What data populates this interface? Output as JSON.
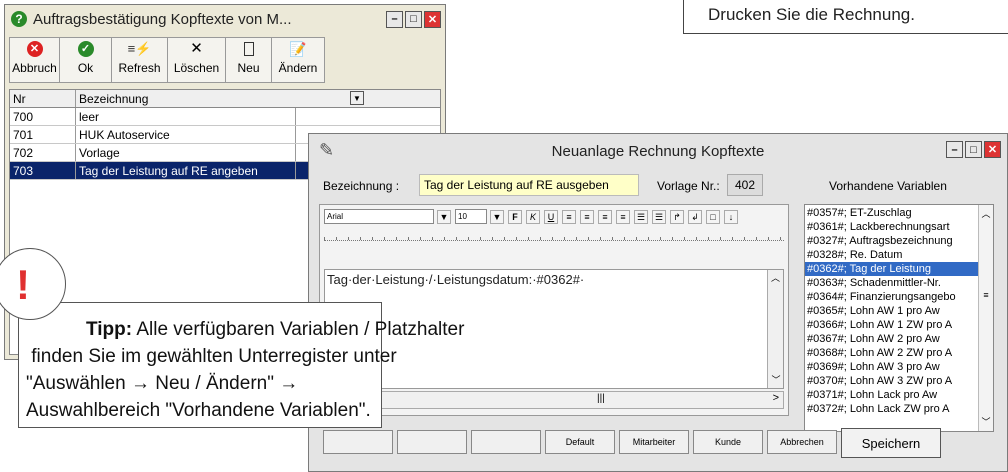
{
  "top_note": "Drucken Sie die Rechnung.",
  "win1": {
    "title": "Auftragsbestätigung  Kopftexte von M...",
    "toolbar": [
      "Abbruch",
      "Ok",
      "Refresh",
      "Löschen",
      "Neu",
      "Ändern"
    ],
    "col_nr": "Nr",
    "col_bez": "Bezeichnung",
    "rows": [
      {
        "nr": "700",
        "bez": "leer"
      },
      {
        "nr": "701",
        "bez": "HUK Autoservice"
      },
      {
        "nr": "702",
        "bez": "Vorlage"
      },
      {
        "nr": "703",
        "bez": "Tag der Leistung auf RE angeben"
      }
    ]
  },
  "win2": {
    "title": "Neuanlage Rechnung Kopftexte",
    "bez_label": "Bezeichnung :",
    "bez_value": "Tag der Leistung auf RE ausgeben",
    "vorlage_label": "Vorlage Nr.:",
    "vorlage_value": "402",
    "vars_header": "Vorhandene Variablen",
    "font": "Arial",
    "size": "10",
    "editor_text": "Tag·der·Leistung·/·Leistungsdatum:·#0362#·",
    "variables": [
      "#0357#; ET-Zuschlag",
      "#0361#; Lackberechnungsart",
      "#0327#; Auftragsbezeichnung",
      "#0328#; Re. Datum",
      "#0362#; Tag der Leistung",
      "#0363#; Schadenmittler-Nr.",
      "#0364#; Finanzierungsangebo",
      "#0365#; Lohn AW 1 pro Aw",
      "#0366#; Lohn AW 1 ZW pro A",
      "#0367#; Lohn AW 2 pro Aw",
      "#0368#; Lohn AW 2 ZW pro A",
      "#0369#; Lohn AW 3 pro Aw",
      "#0370#; Lohn AW 3 ZW pro A",
      "#0371#; Lohn Lack pro Aw",
      "#0372#; Lohn Lack ZW pro A"
    ],
    "bottom_buttons": [
      "Default",
      "Mitarbeiter",
      "Kunde",
      "Abbrechen"
    ],
    "save": "Speichern"
  },
  "tip": {
    "bang": "!",
    "bold": "Tipp:",
    "text1": " Alle verfügbaren Variablen / Platzhalter",
    "text2": " finden Sie im gewählten Unterregister unter",
    "text3": "\"Auswählen → Neu / Ändern\" →",
    "text4": "Auswahlbereich \"Vorhandene Variablen\"."
  }
}
